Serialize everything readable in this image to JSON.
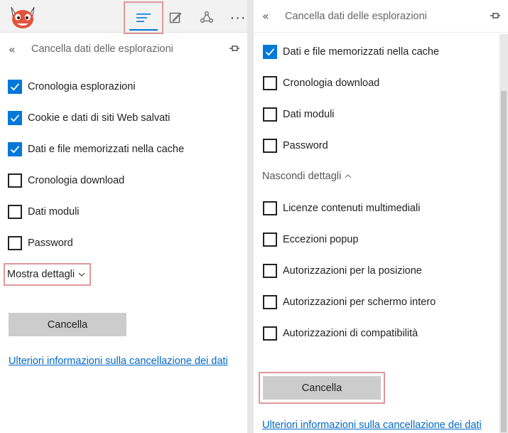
{
  "left": {
    "toolbar": {
      "logo_icon": "red-horned-mascot-logo",
      "hub_icon": "hub-lines-icon",
      "note_icon": "web-note-icon",
      "share_icon": "share-icon",
      "more_label": "···"
    },
    "panel": {
      "back_label": "«",
      "title": "Cancella dati delle esplorazioni",
      "pin_icon": "pin-icon"
    },
    "options": [
      {
        "label": "Cronologia esplorazioni",
        "checked": true
      },
      {
        "label": "Cookie e dati di siti Web salvati",
        "checked": true
      },
      {
        "label": "Dati e file memorizzati nella cache",
        "checked": true
      },
      {
        "label": "Cronologia download",
        "checked": false
      },
      {
        "label": "Dati moduli",
        "checked": false
      },
      {
        "label": "Password",
        "checked": false
      }
    ],
    "details_toggle": "Mostra dettagli",
    "clear_button": "Cancella",
    "more_info_link": "Ulteriori informazioni sulla cancellazione dei dati"
  },
  "right": {
    "panel": {
      "back_label": "«",
      "title": "Cancella dati delle esplorazioni",
      "pin_icon": "pin-icon"
    },
    "options": [
      {
        "label": "Dati e file memorizzati nella cache",
        "checked": true
      },
      {
        "label": "Cronologia download",
        "checked": false
      },
      {
        "label": "Dati moduli",
        "checked": false
      },
      {
        "label": "Password",
        "checked": false
      }
    ],
    "details_toggle": "Nascondi dettagli",
    "details_options": [
      {
        "label": "Licenze contenuti multimediali",
        "checked": false
      },
      {
        "label": "Eccezioni popup",
        "checked": false
      },
      {
        "label": "Autorizzazioni per la posizione",
        "checked": false
      },
      {
        "label": "Autorizzazioni per schermo intero",
        "checked": false
      },
      {
        "label": "Autorizzazioni di compatibilità",
        "checked": false
      }
    ],
    "clear_button": "Cancella",
    "more_info_link": "Ulteriori informazioni sulla cancellazione dei dati"
  },
  "colors": {
    "accent": "#0078d7",
    "highlight_box": "#e0989a",
    "link": "#0068c9",
    "button_bg": "#cccccc"
  }
}
